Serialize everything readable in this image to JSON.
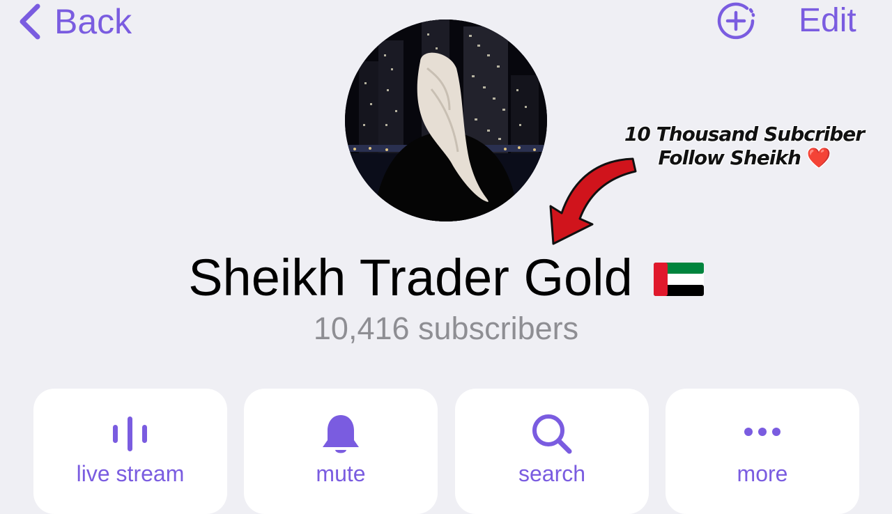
{
  "nav": {
    "back_label": "Back",
    "edit_label": "Edit"
  },
  "annotation": {
    "line1": "10 Thousand Subcriber",
    "line2": "Follow Sheikh",
    "heart": "❤️"
  },
  "channel": {
    "title": "Sheikh Trader Gold",
    "flag": "UAE flag",
    "subscribers": "10,416 subscribers"
  },
  "actions": [
    {
      "label": "live stream",
      "icon": "live-stream-icon"
    },
    {
      "label": "mute",
      "icon": "bell-icon"
    },
    {
      "label": "search",
      "icon": "search-icon"
    },
    {
      "label": "more",
      "icon": "more-dots-icon"
    }
  ],
  "colors": {
    "accent": "#7a5ce0",
    "background": "#efeff4",
    "subtitle": "#8e8e93",
    "annotation_arrow": "#d0141c"
  }
}
